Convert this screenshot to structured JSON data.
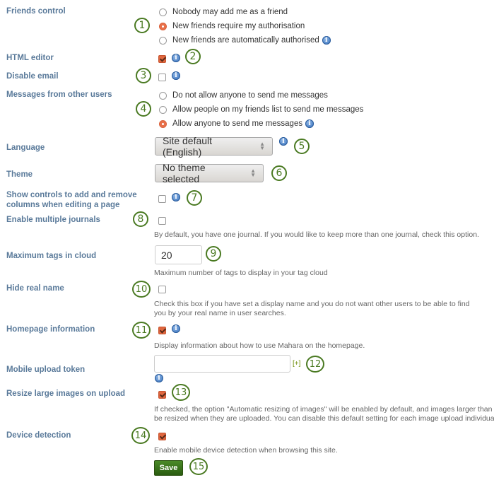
{
  "friends_control": {
    "label": "Friends control",
    "options": [
      "Nobody may add me as a friend",
      "New friends require my authorisation",
      "New friends are automatically authorised"
    ],
    "selected_index": 1,
    "callout": "1"
  },
  "html_editor": {
    "label": "HTML editor",
    "checked": true,
    "callout": "2"
  },
  "disable_email": {
    "label": "Disable email",
    "checked": false,
    "callout": "3"
  },
  "messages": {
    "label": "Messages from other users",
    "options": [
      "Do not allow anyone to send me messages",
      "Allow people on my friends list to send me messages",
      "Allow anyone to send me messages"
    ],
    "selected_index": 2,
    "callout": "4"
  },
  "language": {
    "label": "Language",
    "value": "Site default (English)",
    "callout": "5"
  },
  "theme": {
    "label": "Theme",
    "value": "No theme selected",
    "callout": "6"
  },
  "show_controls": {
    "label_line1": "Show controls to add and remove",
    "label_line2": "columns when editing a page",
    "checked": false,
    "callout": "7"
  },
  "multiple_journals": {
    "label": "Enable multiple journals",
    "checked": false,
    "description": "By default, you have one journal. If you would like to keep more than one journal, check this option.",
    "callout": "8"
  },
  "max_tags": {
    "label": "Maximum tags in cloud",
    "value": "20",
    "description": "Maximum number of tags to display in your tag cloud",
    "callout": "9"
  },
  "hide_real_name": {
    "label": "Hide real name",
    "checked": false,
    "description_line1": "Check this box if you have set a display name and you do not want other users to be able to find",
    "description_line2": "you by your real name in user searches.",
    "callout": "10"
  },
  "homepage_info": {
    "label": "Homepage information",
    "checked": true,
    "description": "Display information about how to use Mahara on the homepage.",
    "callout": "11"
  },
  "mobile_token": {
    "label": "Mobile upload token",
    "value": "",
    "add_link": "[+]",
    "callout": "12"
  },
  "resize_images": {
    "label": "Resize large images on upload",
    "checked": true,
    "description_line1": "If checked, the option \"Automatic resizing of images\" will be enabled by default, and images larger than the maximum dimensions will",
    "description_line2": "be resized when they are uploaded. You can disable this default setting for each image upload individually.",
    "callout": "13"
  },
  "device_detection": {
    "label": "Device detection",
    "checked": true,
    "description": "Enable mobile device detection when browsing this site.",
    "callout": "14"
  },
  "save": {
    "label": "Save",
    "callout": "15"
  },
  "icons": {
    "info": "i"
  },
  "colors": {
    "label": "#5a7a9a",
    "accent": "#e0673f",
    "callout": "#4a7a22",
    "save_button": "#3a7a1c"
  }
}
